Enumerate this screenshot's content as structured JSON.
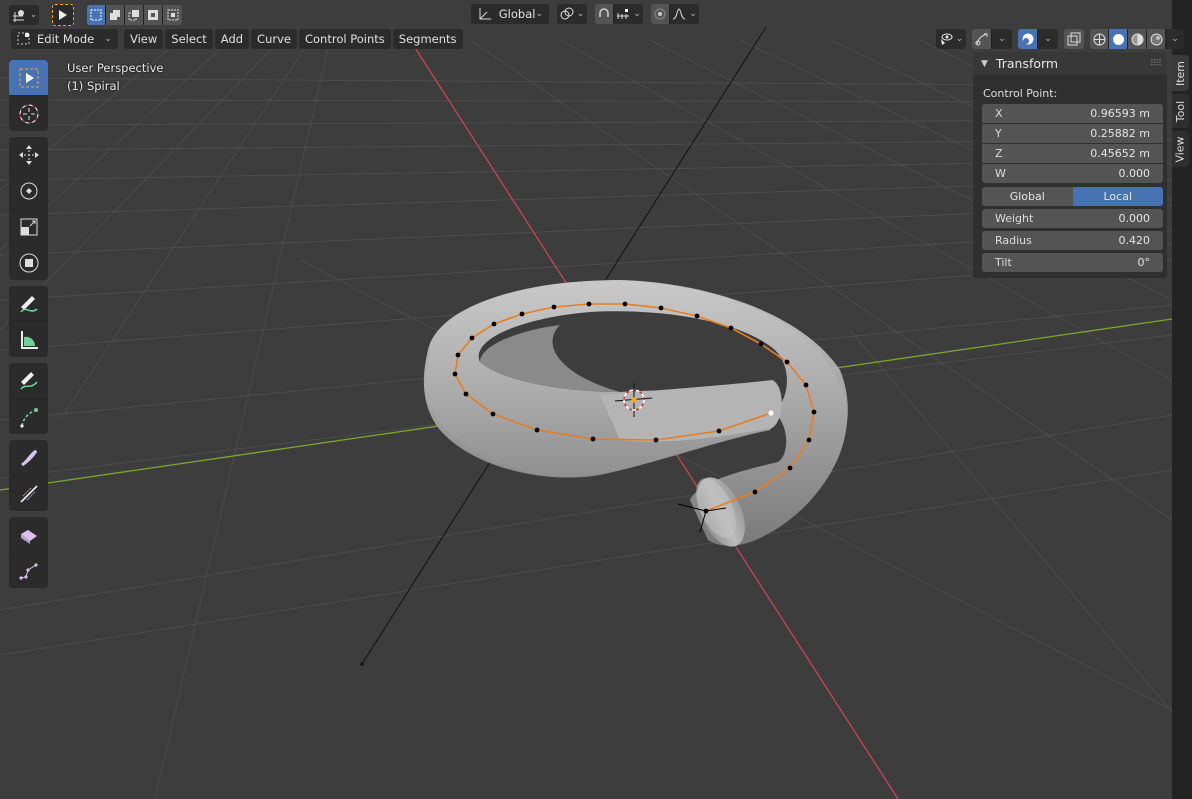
{
  "header": {
    "editor_type_icon": "viewport-3d-icon",
    "select_tool_icon": "cursor-arrow-icon",
    "select_modes": [
      "set-new-icon",
      "extend-icon",
      "subtract-icon",
      "invert-icon",
      "intersect-icon"
    ],
    "transform_orientation": "Global",
    "pivot_icon": "pivot-point-icon",
    "snap_icon": "magnet-icon",
    "snap_target_icon": "snap-increment-icon",
    "proportional_icon": "proportional-edit-icon",
    "falloff_icon": "falloff-curve-icon"
  },
  "menu": {
    "mode": "Edit Mode",
    "items": [
      "View",
      "Select",
      "Add",
      "Curve",
      "Control Points",
      "Segments"
    ]
  },
  "viewport_header_right": {
    "visibility_icon": "selectability-visibility-icon",
    "gizmo_icon": "gizmo-icon",
    "overlay_icon": "overlays-icon",
    "xray_icon": "xray-icon",
    "shading_modes": [
      "wireframe",
      "solid",
      "material-preview",
      "rendered"
    ],
    "active_shading": "solid"
  },
  "overlay_text": {
    "view_name": "User Perspective",
    "object_name": "(1) Spiral"
  },
  "toolbar": {
    "tools": [
      {
        "name": "select-box",
        "group": 0,
        "active": true
      },
      {
        "name": "cursor",
        "group": 0
      },
      {
        "name": "move",
        "group": 1
      },
      {
        "name": "rotate",
        "group": 1
      },
      {
        "name": "scale",
        "group": 1
      },
      {
        "name": "transform",
        "group": 1
      },
      {
        "name": "annotate",
        "group": 2
      },
      {
        "name": "measure",
        "group": 2
      },
      {
        "name": "draw",
        "group": 3
      },
      {
        "name": "extrude",
        "group": 3
      },
      {
        "name": "radius",
        "group": 4
      },
      {
        "name": "tilt",
        "group": 4
      },
      {
        "name": "randomize",
        "group": 5
      },
      {
        "name": "curve-pen",
        "group": 5
      }
    ]
  },
  "sidebar": {
    "tabs": [
      "Item",
      "Tool",
      "View"
    ],
    "active_tab": "Item",
    "panel_title": "Transform",
    "section_label": "Control Point:",
    "fields": [
      {
        "label": "X",
        "value": "0.96593 m"
      },
      {
        "label": "Y",
        "value": "0.25882 m"
      },
      {
        "label": "Z",
        "value": "0.45652 m"
      },
      {
        "label": "W",
        "value": "0.000"
      }
    ],
    "space_toggle": {
      "options": [
        "Global",
        "Local"
      ],
      "active": "Local"
    },
    "props": [
      {
        "label": "Weight",
        "value": "0.000"
      },
      {
        "label": "Radius",
        "value": "0.420"
      },
      {
        "label": "Tilt",
        "value": "0°"
      }
    ]
  },
  "colors": {
    "accent": "#4772b3",
    "x_axis": "#c9474f",
    "y_axis": "#7da62a",
    "curve_edge": "#e67e22",
    "viewport_bg": "#3d3d3d",
    "grid": "#4b4b4b"
  }
}
